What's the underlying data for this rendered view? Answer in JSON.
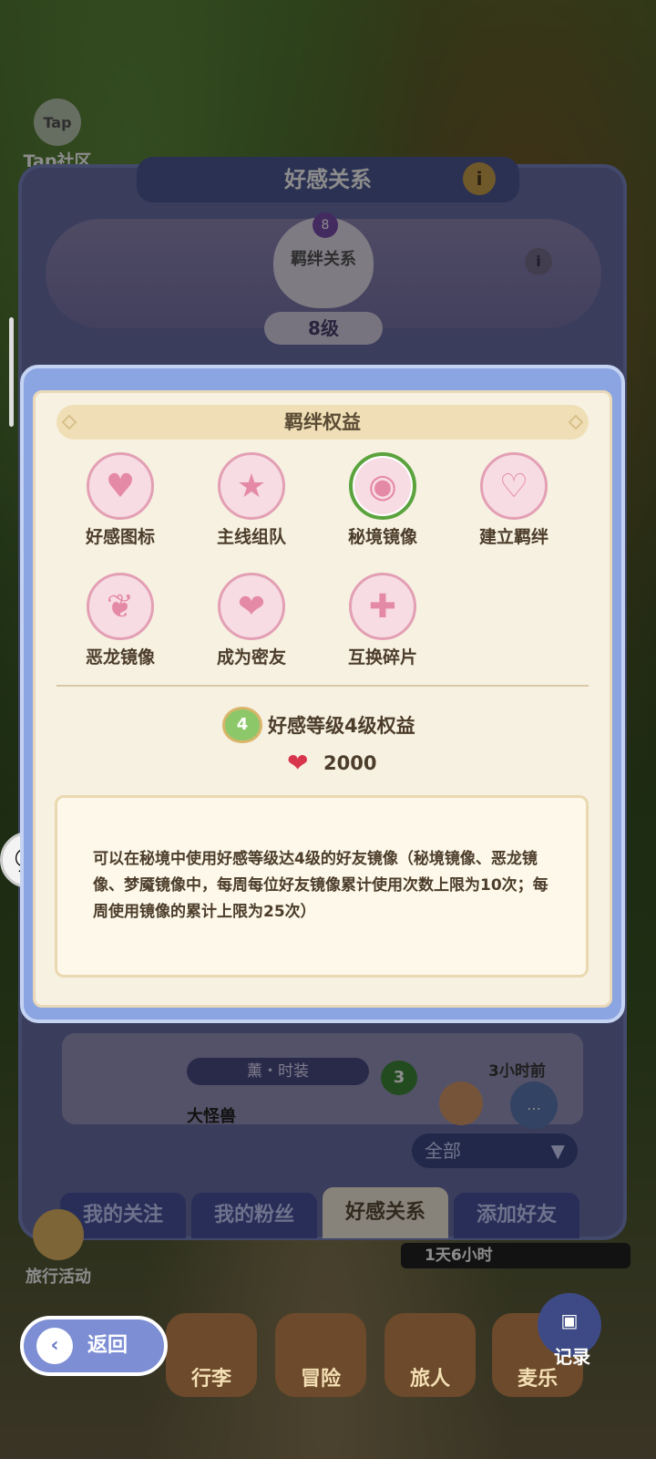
{
  "tap_community": {
    "icon_text": "Tap",
    "label": "Tap社区"
  },
  "back_panel": {
    "title": "好感关系",
    "bond_heart_label": "羁绊关系",
    "bond_level_badge": "8",
    "bond_level": "8级",
    "friend": {
      "outfit": "薰・时装",
      "name": "大怪兽",
      "affinity_level": "3",
      "time_ago": "3小时前"
    },
    "filter": {
      "selected": "全部"
    },
    "tabs": [
      {
        "label": "我的关注"
      },
      {
        "label": "我的粉丝"
      },
      {
        "label": "好感关系"
      },
      {
        "label": "添加好友"
      }
    ]
  },
  "travel_event": {
    "label": "旅行活动"
  },
  "timer": {
    "text": "1天6小时"
  },
  "modal": {
    "title": "羁绊权益",
    "benefits": [
      {
        "label": "好感图标",
        "icon": "heart-icon"
      },
      {
        "label": "主线组队",
        "icon": "team-icon"
      },
      {
        "label": "秘境镜像",
        "icon": "eye-icon",
        "selected": true
      },
      {
        "label": "建立羁绊",
        "icon": "rings-icon"
      },
      {
        "label": "恶龙镜像",
        "icon": "dragon-icon"
      },
      {
        "label": "成为密友",
        "icon": "double-heart-icon"
      },
      {
        "label": "互换碎片",
        "icon": "puzzle-icon"
      }
    ],
    "level_badge": "4",
    "level_title": "好感等级4级权益",
    "cost": "2000",
    "description": "可以在秘境中使用好感等级达4级的好友镜像（秘境镜像、恶龙镜像、梦魇镜像中，每周每位好友镜像累计使用次数上限为10次；每周使用镜像的累计上限为25次）"
  },
  "bottom_nav": {
    "back_label": "返回",
    "items": [
      {
        "label": "行李"
      },
      {
        "label": "冒险"
      },
      {
        "label": "旅人"
      },
      {
        "label": "麦乐"
      }
    ],
    "record_label": "记录"
  },
  "colors": {
    "accent_pink": "#e58aa6",
    "selected_green": "#5aa33d",
    "modal_frame": "#8ba4e2"
  }
}
